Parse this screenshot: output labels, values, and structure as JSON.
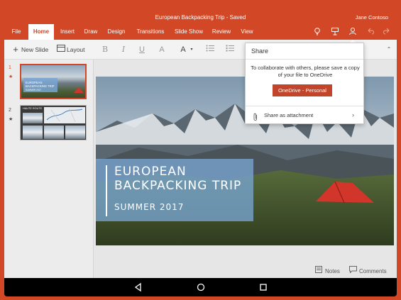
{
  "titlebar": {
    "doc_title": "European Backpacking Trip - Saved",
    "user_name": "Jane Contoso"
  },
  "ribbon": {
    "tabs": [
      "File",
      "Home",
      "Insert",
      "Draw",
      "Design",
      "Transitions",
      "Slide Show",
      "Review",
      "View"
    ],
    "active_tab": "Home"
  },
  "toolbar": {
    "new_slide": "New Slide",
    "layout": "Layout",
    "bold": "B",
    "italic": "I",
    "underline": "U",
    "font_color_glyph": "A",
    "font_size_glyph": "A"
  },
  "thumbnails": [
    {
      "number": "1",
      "star": "★",
      "title_text": "EUROPEAN BACKPACKING TRIP",
      "subtitle_text": "SUMMER 2017"
    },
    {
      "number": "2",
      "star": "★",
      "title_text": "HAUTE ROUTE"
    }
  ],
  "slide": {
    "title": "EUROPEAN BACKPACKING TRIP",
    "subtitle": "SUMMER 2017"
  },
  "statusbar": {
    "notes": "Notes",
    "comments": "Comments"
  },
  "share": {
    "title": "Share",
    "message": "To collaborate with others, please save a copy of your file to OneDrive",
    "button_label": "OneDrive - Personal",
    "attach_label": "Share as attachment"
  },
  "colors": {
    "accent": "#d24726",
    "button": "#c0452b"
  }
}
